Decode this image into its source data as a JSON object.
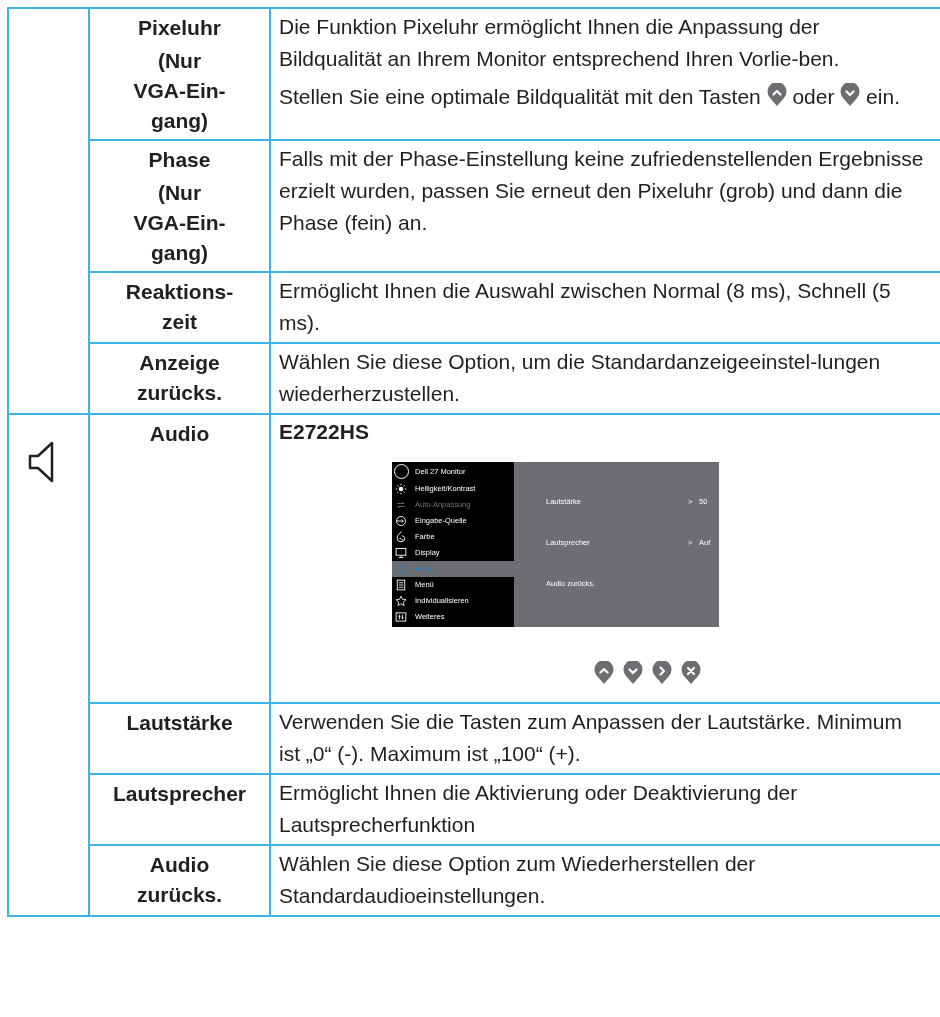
{
  "sections": [
    {
      "rows": [
        {
          "name": "Pixeluhr",
          "note": "(Nur VGA-Ein-gang)",
          "paragraphs": [
            [
              {
                "kind": "text",
                "text": "Die Funktion Pixeluhr ermöglicht Ihnen die Anpassung der Bildqualität an Ihrem Monitor entsprechend Ihren Vorlie-ben."
              }
            ],
            [
              {
                "kind": "text",
                "text": "Stellen Sie eine optimale Bildqualität mit den Tasten "
              },
              {
                "kind": "key-up"
              },
              {
                "kind": "text",
                "text": " oder "
              },
              {
                "kind": "key-down"
              },
              {
                "kind": "text",
                "text": " ein."
              }
            ]
          ]
        },
        {
          "name": "Phase",
          "note": "(Nur VGA-Ein-gang)",
          "paragraphs": [
            [
              {
                "kind": "text",
                "text": "Falls mit der Phase-Einstellung keine zufriedenstellenden Ergebnisse erzielt wurden, passen Sie erneut den Pixeluhr (grob) und dann die Phase (fein) an."
              }
            ]
          ]
        },
        {
          "name": "Reaktions-zeit",
          "paragraphs": [
            [
              {
                "kind": "text",
                "text": "Ermöglicht Ihnen die Auswahl zwischen Normal (8 ms), Schnell (5 ms)."
              }
            ]
          ]
        },
        {
          "name": "Anzeige zurücks.",
          "paragraphs": [
            [
              {
                "kind": "text",
                "text": "Wählen Sie diese Option, um die Standardanzeigeeinstel-lungen wiederherzustellen."
              }
            ]
          ]
        }
      ]
    },
    {
      "rows": [
        {
          "name": "Audio",
          "heading": "E2722HS",
          "osd": {
            "title": "Dell 27 Monitor",
            "menu": [
              {
                "label": "Helligkeit/Kontrast",
                "selected": false,
                "disabled": false
              },
              {
                "label": "Auto-Anpassung",
                "selected": false,
                "disabled": true
              },
              {
                "label": "Eingabe-Quelle",
                "selected": false,
                "disabled": false
              },
              {
                "label": "Farbe",
                "selected": false,
                "disabled": false
              },
              {
                "label": "Display",
                "selected": false,
                "disabled": false
              },
              {
                "label": "Audio",
                "selected": true,
                "disabled": false
              },
              {
                "label": "Menü",
                "selected": false,
                "disabled": false
              },
              {
                "label": "Individualisieren",
                "selected": false,
                "disabled": false
              },
              {
                "label": "Weiteres",
                "selected": false,
                "disabled": false
              }
            ],
            "settings": [
              {
                "label": "Lautstärke",
                "arrow": ">",
                "value": "50"
              },
              {
                "label": "Lautsprecher",
                "arrow": ">",
                "value": "Auf"
              },
              {
                "label": "Audio zurücks."
              }
            ]
          }
        },
        {
          "name": "Lautstärke",
          "paragraphs": [
            [
              {
                "kind": "text",
                "text": "Verwenden Sie die Tasten zum Anpassen der Lautstärke. Minimum ist „0“ (-). Maximum ist „100“ (+)."
              }
            ]
          ]
        },
        {
          "name": "Lautsprecher",
          "paragraphs": [
            [
              {
                "kind": "text",
                "text": "Ermöglicht Ihnen die Aktivierung oder Deaktivierung der Lautsprecherfunktion"
              }
            ]
          ]
        },
        {
          "name": "Audio zurücks.",
          "paragraphs": [
            [
              {
                "kind": "text",
                "text": "Wählen Sie diese Option zum Wiederherstellen der Standardaudioeinstellungen."
              }
            ]
          ]
        }
      ]
    }
  ]
}
